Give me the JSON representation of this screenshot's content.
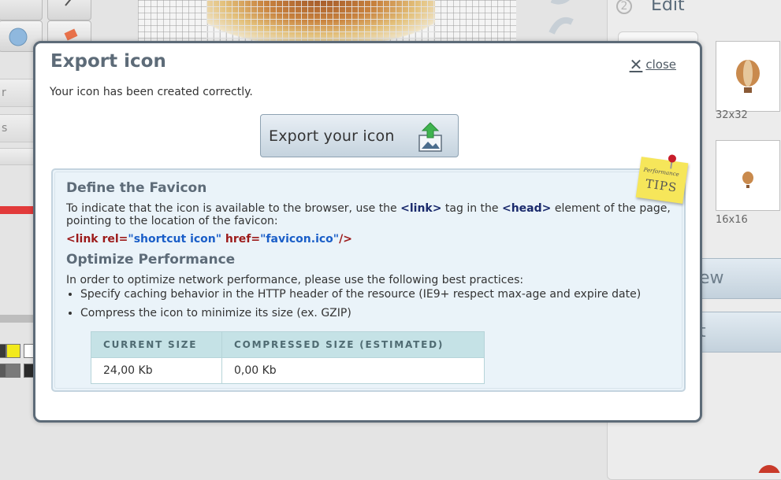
{
  "background": {
    "edit_step_number": "2",
    "edit_title": "Edit",
    "previews": [
      {
        "label": "32x32"
      },
      {
        "label": "16x16"
      }
    ],
    "side_labels": [
      "r",
      "s"
    ],
    "partial_buttons": [
      "ew",
      "t"
    ]
  },
  "modal": {
    "title": "Export icon",
    "close_label": "close",
    "message": "Your icon has been created correctly.",
    "export_button_label": "Export your icon",
    "tips_note": {
      "small": "Performance",
      "big": "TIPS"
    },
    "favicon": {
      "heading": "Define the Favicon",
      "text_1": "To indicate that the icon is available to the browser, use the ",
      "link_tag": "<link>",
      "text_2": " tag in the ",
      "head_tag": "<head>",
      "text_3": "  element of the page, pointing to the location of the favicon:",
      "code": {
        "open": "<link",
        "attr1": "rel=",
        "val1": "\"shortcut icon\"",
        "attr2": "href=",
        "val2": "\"favicon.ico\"",
        "close": "/>"
      }
    },
    "performance": {
      "heading": "Optimize Performance",
      "intro": "In order to optimize network performance, please use the following best practices:",
      "practices": [
        "Specify caching behavior in the HTTP header of the resource (IE9+ respect max-age and expire date)",
        "Compress the icon to minimize its size (ex. GZIP)"
      ],
      "table": {
        "headers": [
          "CURRENT SIZE",
          "COMPRESSED SIZE (ESTIMATED)"
        ],
        "row": [
          "24,00 Kb",
          "0,00 Kb"
        ]
      }
    }
  },
  "colors": {
    "modal_border": "#5d6b78",
    "code_tag": "#9c1a1a",
    "code_value": "#1a5ec8",
    "table_header_bg": "#c5e2e6"
  }
}
